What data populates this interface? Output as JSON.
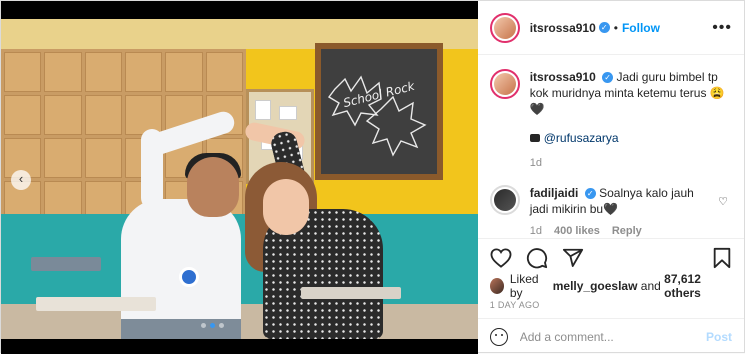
{
  "post": {
    "author": {
      "username": "itsrossa910",
      "verified": true,
      "follow_label": "Follow",
      "separator": "•"
    },
    "caption": {
      "username": "itsrossa910",
      "text": "Jadi guru bimbel tp kok muridnya minta ketemu terus 😩🖤",
      "tagged_user": "@rufusazarya",
      "age": "1d"
    },
    "comments": [
      {
        "username": "fadiljaidi",
        "verified": true,
        "text": "Soalnya kalo jauh jadi mikirin bu🖤",
        "age": "1d",
        "likes": "400 likes",
        "reply_label": "Reply"
      }
    ],
    "likes": {
      "prefix": "Liked by",
      "user": "melly_goeslaw",
      "connector": "and",
      "others": "87,612 others"
    },
    "date": "1 DAY AGO",
    "add_comment": {
      "placeholder": "Add a comment...",
      "post_label": "Post"
    },
    "carousel": {
      "prev_symbol": "‹",
      "total": 3,
      "active": 1
    },
    "photo": {
      "board_text": "School Rock"
    },
    "icons": {
      "heart": "heart-icon",
      "comment": "comment-icon",
      "share": "share-icon",
      "save": "bookmark-icon",
      "more": "more-options-icon",
      "emoji": "emoji-icon",
      "camera": "camera-icon"
    },
    "colors": {
      "link_blue": "#0095f6",
      "verified_blue": "#3897f0",
      "post_disabled": "#b3dbff",
      "muted": "#8e8e8e"
    }
  }
}
